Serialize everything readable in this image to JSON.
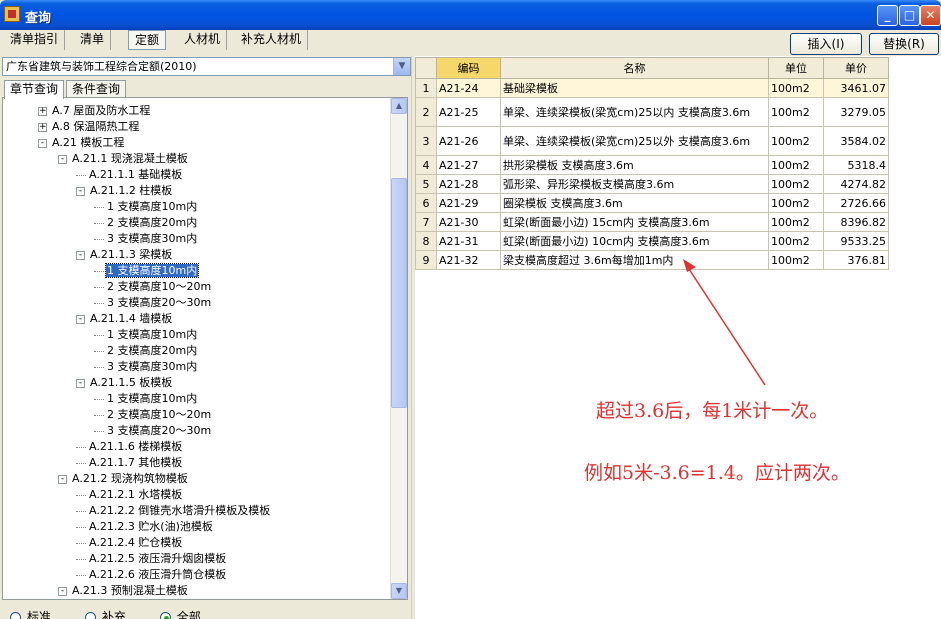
{
  "window": {
    "title": "查询"
  },
  "top_tabs": [
    "清单指引",
    "清单",
    "定额",
    "人材机",
    "补充人材机"
  ],
  "buttons": {
    "insert": "插入(I)",
    "replace": "替换(R)"
  },
  "left": {
    "dropdown_value": "广东省建筑与装饰工程综合定额(2010)",
    "subtabs": [
      "章节查询",
      "条件查询"
    ],
    "tree": [
      {
        "label": "A.7 屋面及防水工程",
        "level": 0,
        "exp": "+"
      },
      {
        "label": "A.8 保温隔热工程",
        "level": 0,
        "exp": "+"
      },
      {
        "label": "A.21 模板工程",
        "level": 0,
        "exp": "-"
      },
      {
        "label": "A.21.1 现浇混凝土模板",
        "level": 1,
        "exp": "-"
      },
      {
        "label": "A.21.1.1 基础模板",
        "level": 2,
        "exp": ""
      },
      {
        "label": "A.21.1.2 柱模板",
        "level": 2,
        "exp": "-"
      },
      {
        "label": "1 支模高度10m内",
        "level": 3,
        "exp": ""
      },
      {
        "label": "2 支模高度20m内",
        "level": 3,
        "exp": ""
      },
      {
        "label": "3 支模高度30m内",
        "level": 3,
        "exp": ""
      },
      {
        "label": "A.21.1.3 梁模板",
        "level": 2,
        "exp": "-"
      },
      {
        "label": "1 支模高度10m内",
        "level": 3,
        "exp": "",
        "selected": true
      },
      {
        "label": "2 支模高度10～20m",
        "level": 3,
        "exp": ""
      },
      {
        "label": "3 支模高度20～30m",
        "level": 3,
        "exp": ""
      },
      {
        "label": "A.21.1.4 墙模板",
        "level": 2,
        "exp": "-"
      },
      {
        "label": "1 支模高度10m内",
        "level": 3,
        "exp": ""
      },
      {
        "label": "2 支模高度20m内",
        "level": 3,
        "exp": ""
      },
      {
        "label": "3 支模高度30m内",
        "level": 3,
        "exp": ""
      },
      {
        "label": "A.21.1.5 板模板",
        "level": 2,
        "exp": "-"
      },
      {
        "label": "1 支模高度10m内",
        "level": 3,
        "exp": ""
      },
      {
        "label": "2 支模高度10～20m",
        "level": 3,
        "exp": ""
      },
      {
        "label": "3 支模高度20～30m",
        "level": 3,
        "exp": ""
      },
      {
        "label": "A.21.1.6 楼梯模板",
        "level": 2,
        "exp": ""
      },
      {
        "label": "A.21.1.7 其他模板",
        "level": 2,
        "exp": ""
      },
      {
        "label": "A.21.2 现浇构筑物模板",
        "level": 1,
        "exp": "-"
      },
      {
        "label": "A.21.2.1 水塔模板",
        "level": 2,
        "exp": ""
      },
      {
        "label": "A.21.2.2 倒锥壳水塔滑升模板及模板",
        "level": 2,
        "exp": ""
      },
      {
        "label": "A.21.2.3 贮水(油)池模板",
        "level": 2,
        "exp": ""
      },
      {
        "label": "A.21.2.4 贮仓模板",
        "level": 2,
        "exp": ""
      },
      {
        "label": "A.21.2.5 液压滑升烟囱模板",
        "level": 2,
        "exp": ""
      },
      {
        "label": "A.21.2.6 液压滑升筒仓模板",
        "level": 2,
        "exp": ""
      },
      {
        "label": "A.21.3 预制混凝土模板",
        "level": 1,
        "exp": "-"
      }
    ],
    "radios": [
      {
        "label": "标准",
        "checked": false
      },
      {
        "label": "补充",
        "checked": false
      },
      {
        "label": "全部",
        "checked": true
      }
    ]
  },
  "table": {
    "headers": [
      "",
      "编码",
      "名称",
      "单位",
      "单价"
    ],
    "rows": [
      {
        "no": "1",
        "code": "A21-24",
        "name": "基础梁模板",
        "unit": "100m2",
        "price": "3461.07"
      },
      {
        "no": "2",
        "code": "A21-25",
        "name": "单梁、连续梁模板(梁宽cm)25以内 支模高度3.6m",
        "unit": "100m2",
        "price": "3279.05"
      },
      {
        "no": "3",
        "code": "A21-26",
        "name": "单梁、连续梁模板(梁宽cm)25以外 支模高度3.6m",
        "unit": "100m2",
        "price": "3584.02"
      },
      {
        "no": "4",
        "code": "A21-27",
        "name": "拱形梁模板  支模高度3.6m",
        "unit": "100m2",
        "price": "5318.4"
      },
      {
        "no": "5",
        "code": "A21-28",
        "name": "弧形梁、异形梁模板支模高度3.6m",
        "unit": "100m2",
        "price": "4274.82"
      },
      {
        "no": "6",
        "code": "A21-29",
        "name": "圈梁模板  支模高度3.6m",
        "unit": "100m2",
        "price": "2726.66"
      },
      {
        "no": "7",
        "code": "A21-30",
        "name": "虹梁(断面最小边) 15cm内 支模高度3.6m",
        "unit": "100m2",
        "price": "8396.82"
      },
      {
        "no": "8",
        "code": "A21-31",
        "name": "虹梁(断面最小边) 10cm内 支模高度3.6m",
        "unit": "100m2",
        "price": "9533.25"
      },
      {
        "no": "9",
        "code": "A21-32",
        "name": "梁支模高度超过 3.6m每增加1m内",
        "unit": "100m2",
        "price": "376.81"
      }
    ]
  },
  "annotations": {
    "line1": "超过3.6后，每1米计一次。",
    "line2": "例如5米-3.6=1.4。应计两次。",
    "color": "#e03030"
  }
}
